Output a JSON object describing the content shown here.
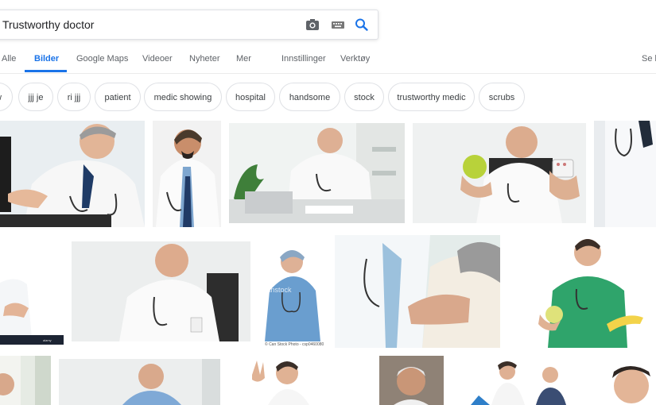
{
  "search": {
    "query": "Trustworthy doctor"
  },
  "icons": {
    "camera": "camera-icon",
    "keyboard": "keyboard-icon",
    "search": "search-icon"
  },
  "tabs": [
    {
      "label": "Alle"
    },
    {
      "label": "Bilder",
      "active": true
    },
    {
      "label": "Google Maps"
    },
    {
      "label": "Videoer"
    },
    {
      "label": "Nyheter"
    },
    {
      "label": "Mer"
    },
    {
      "label": "Innstillinger"
    },
    {
      "label": "Verktøy"
    },
    {
      "label": "Se l"
    }
  ],
  "chips": [
    "w",
    "jjj je",
    "ri jjj",
    "patient",
    "medic showing",
    "hospital",
    "handsome",
    "stock",
    "trustworthy medic",
    "scrubs"
  ],
  "captions": {
    "canstock": "© Can Stock Photo - csp0460080"
  },
  "colors": {
    "accent": "#1a73e8",
    "tab_text": "#5f6368",
    "chip_border": "#dfe1e5",
    "icon_grey": "#5f6368"
  }
}
